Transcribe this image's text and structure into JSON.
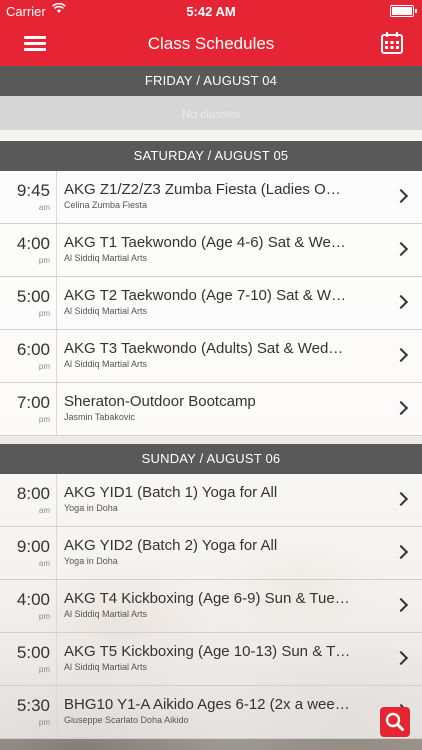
{
  "status": {
    "carrier": "Carrier",
    "time": "5:42 AM"
  },
  "nav": {
    "title": "Class Schedules"
  },
  "days": [
    {
      "header": "FRIDAY / AUGUST 04",
      "empty_text": "No classes",
      "classes": []
    },
    {
      "header": "SATURDAY / AUGUST 05",
      "classes": [
        {
          "time": "9:45",
          "ampm": "am",
          "name": "AKG Z1/Z2/Z3 Zumba Fiesta (Ladies O…",
          "instructor": "Celina Zumba Fiesta"
        },
        {
          "time": "4:00",
          "ampm": "pm",
          "name": "AKG T1 Taekwondo (Age 4-6) Sat & We…",
          "instructor": "Al Siddiq Martial Arts"
        },
        {
          "time": "5:00",
          "ampm": "pm",
          "name": "AKG T2 Taekwondo (Age 7-10) Sat & W…",
          "instructor": "Al Siddiq Martial Arts"
        },
        {
          "time": "6:00",
          "ampm": "pm",
          "name": "AKG T3 Taekwondo (Adults) Sat & Wed…",
          "instructor": "Al Siddiq Martial Arts"
        },
        {
          "time": "7:00",
          "ampm": "pm",
          "name": "Sheraton-Outdoor Bootcamp",
          "instructor": "Jasmin Tabakovic"
        }
      ]
    },
    {
      "header": "SUNDAY / AUGUST 06",
      "classes": [
        {
          "time": "8:00",
          "ampm": "am",
          "name": "AKG YID1 (Batch 1) Yoga for All",
          "instructor": "Yoga in Doha"
        },
        {
          "time": "9:00",
          "ampm": "am",
          "name": "AKG YID2 (Batch 2) Yoga for All",
          "instructor": "Yoga in Doha"
        },
        {
          "time": "4:00",
          "ampm": "pm",
          "name": "AKG T4 Kickboxing (Age 6-9) Sun & Tue…",
          "instructor": "Al Siddiq Martial Arts"
        },
        {
          "time": "5:00",
          "ampm": "pm",
          "name": "AKG T5 Kickboxing (Age 10-13) Sun & T…",
          "instructor": "Al Siddiq Martial Arts"
        },
        {
          "time": "5:30",
          "ampm": "pm",
          "name": "BHG10 Y1-A Aikido Ages 6-12 (2x a wee…",
          "instructor": "Giuseppe Scarlato Doha Aikido"
        }
      ]
    }
  ],
  "colors": {
    "brand": "#e52534",
    "section_header": "#595959"
  },
  "icons": {
    "menu": "menu-icon",
    "calendar": "calendar-icon",
    "search": "search-icon",
    "chevron": "chevron-right-icon"
  }
}
